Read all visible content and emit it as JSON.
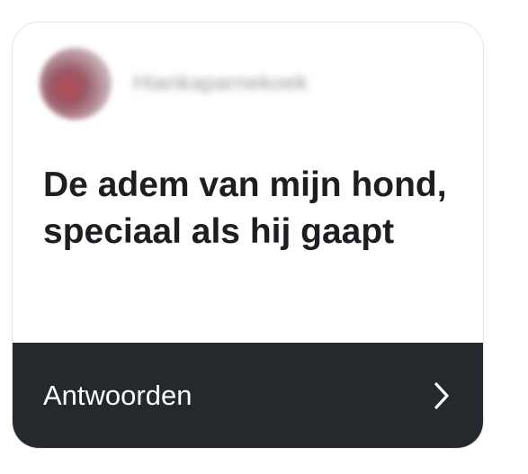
{
  "post": {
    "username": "Hiankaparnekoek",
    "question": "De adem van mijn hond, speciaal als hij gaapt",
    "reply_label": "Antwoorden"
  },
  "icons": {
    "avatar": "avatar-photo",
    "chevron": "chevron-right-icon"
  },
  "colors": {
    "footer_background": "#25282d",
    "question_text": "#1c1e22",
    "footer_text": "#ffffff"
  }
}
